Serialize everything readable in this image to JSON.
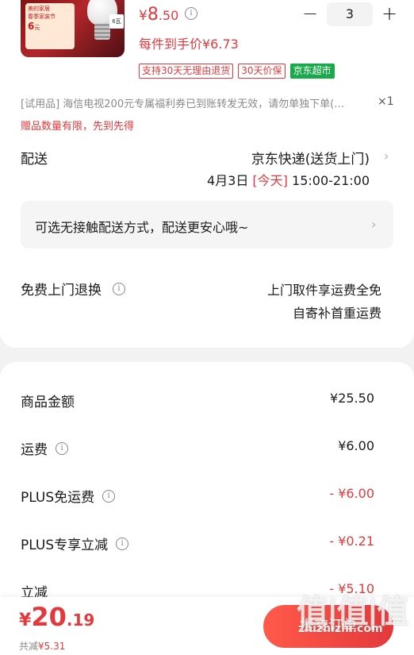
{
  "product": {
    "image_alt": "product-image",
    "banner_lines": [
      "美的家居",
      "春季家装节",
      "6",
      "元"
    ],
    "tag6": "6瓦",
    "price_symbol": "¥",
    "price_int": "8",
    "price_dec": ".50",
    "quantity": "3",
    "minus_label": "−",
    "plus_label": "+",
    "hand_price": "每件到手价¥6.73",
    "tags": [
      "支持30天无理由退货",
      "30天价保"
    ],
    "store_tag": "京东超市"
  },
  "trial": {
    "text": "[试用品]  海信电视200元专属福利券已到账转发无效，请勿单独下单(…",
    "close": "×1"
  },
  "gift_note": "赠品数量有限，先到先得",
  "delivery": {
    "label": "配送",
    "method": "京东快递(送货上门)",
    "date": "4月3日 ",
    "today": "[今天]",
    "time": " 15:00-21:00",
    "contactless": "可选无接触配送方式，配送更安心哦~"
  },
  "return": {
    "label": "免费上门退换",
    "line1": "上门取件享运费全免",
    "line2": "自寄补首重运费"
  },
  "fees": [
    {
      "label": "商品金额",
      "value": "¥25.50",
      "info": false,
      "red": false
    },
    {
      "label": "运费",
      "value": "¥6.00",
      "info": true,
      "red": false
    },
    {
      "label": "PLUS免运费",
      "value": "- ¥6.00",
      "info": true,
      "red": true
    },
    {
      "label": "PLUS专享立减",
      "value": "- ¥0.21",
      "info": true,
      "red": true
    },
    {
      "label": "立减",
      "value": "- ¥5.10",
      "info": false,
      "red": true
    }
  ],
  "bottom": {
    "total_symbol": "¥",
    "total_int": "20",
    "total_dec": ".19",
    "saved_label": "共减",
    "saved_value": "¥5.31",
    "submit": "提交订单"
  },
  "watermark": {
    "logo": "值|值|值",
    "url": "zhizhizhi.com"
  },
  "icons": {
    "info": "info-icon",
    "chevron": "chevron-right-icon"
  },
  "colors": {
    "accent": "#e4393c",
    "store_green": "#19a84a"
  }
}
